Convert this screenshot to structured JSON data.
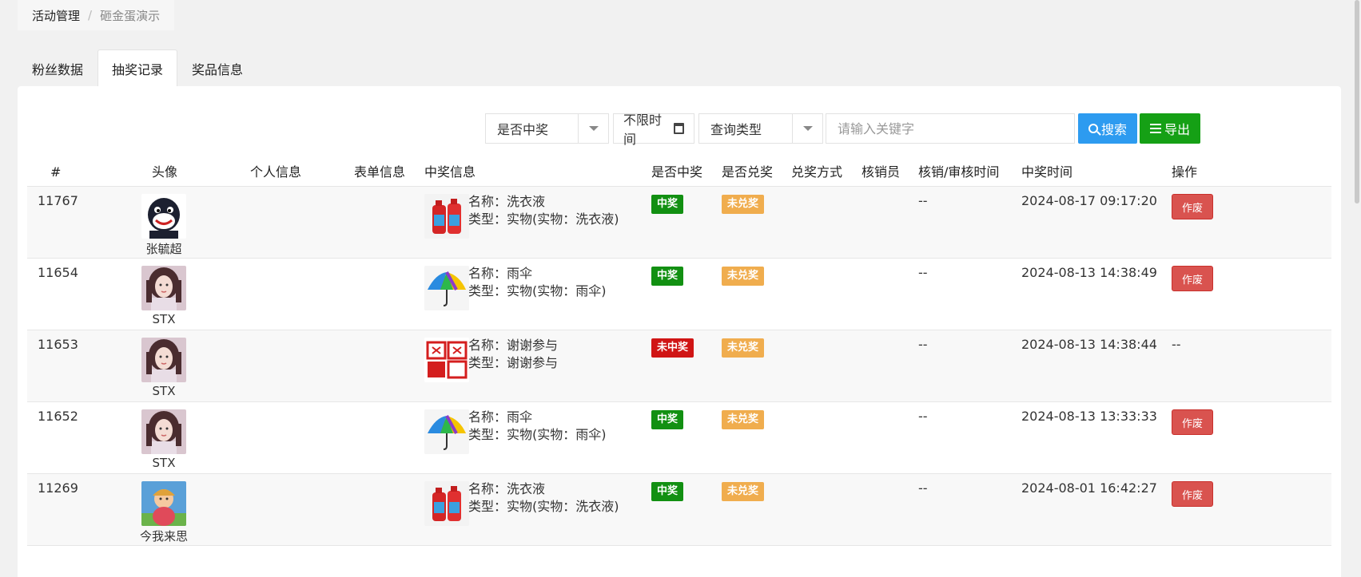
{
  "breadcrumb": {
    "first": "活动管理",
    "sep": "/",
    "current": "砸金蛋演示"
  },
  "tabs": [
    "粉丝数据",
    "抽奖记录",
    "奖品信息"
  ],
  "filters": {
    "win_select": "是否中奖",
    "date_label": "不限时间",
    "query_type": "查询类型",
    "keyword_placeholder": "请输入关键字",
    "search_label": "搜索",
    "export_label": "导出"
  },
  "columns": [
    "#",
    "头像",
    "个人信息",
    "表单信息",
    "中奖信息",
    "是否中奖",
    "是否兑奖",
    "兑奖方式",
    "核销员",
    "核销/审核时间",
    "中奖时间",
    "操作"
  ],
  "prize_name_prefix": "名称：",
  "prize_type_prefix": "类型：",
  "rows": [
    {
      "id": "11767",
      "nickname": "张毓超",
      "avatar": "penguin",
      "prize_name": "洗衣液",
      "prize_type": "实物(实物：洗衣液)",
      "prize_img": "detergent-icon",
      "win": "中奖",
      "redeem": "未兑奖",
      "verify_time": "--",
      "win_time": "2024-08-17 09:17:20",
      "action": "作废"
    },
    {
      "id": "11654",
      "nickname": "STX",
      "avatar": "girl",
      "prize_name": "雨伞",
      "prize_type": "实物(实物：雨伞)",
      "prize_img": "umbrella-icon",
      "win": "中奖",
      "redeem": "未兑奖",
      "verify_time": "--",
      "win_time": "2024-08-13 14:38:49",
      "action": "作废"
    },
    {
      "id": "11653",
      "nickname": "STX",
      "avatar": "girl",
      "prize_name": "谢谢参与",
      "prize_type": "谢谢参与",
      "prize_img": "thanks-icon",
      "win": "未中奖",
      "redeem": "未兑奖",
      "verify_time": "--",
      "win_time": "2024-08-13 14:38:44",
      "action": "--"
    },
    {
      "id": "11652",
      "nickname": "STX",
      "avatar": "girl",
      "prize_name": "雨伞",
      "prize_type": "实物(实物：雨伞)",
      "prize_img": "umbrella-icon",
      "win": "中奖",
      "redeem": "未兑奖",
      "verify_time": "--",
      "win_time": "2024-08-13 13:33:33",
      "action": "作废"
    },
    {
      "id": "11269",
      "nickname": "今我来思",
      "avatar": "cartoon",
      "prize_name": "洗衣液",
      "prize_type": "实物(实物：洗衣液)",
      "prize_img": "detergent-icon",
      "win": "中奖",
      "redeem": "未兑奖",
      "verify_time": "--",
      "win_time": "2024-08-01 16:42:27",
      "action": "作废"
    }
  ],
  "colors": {
    "win": "#129012",
    "lose": "#d01515",
    "unredeemed": "#f0ad4e",
    "search": "#2d9bf0",
    "export": "#15a015",
    "void": "#d9534f"
  }
}
